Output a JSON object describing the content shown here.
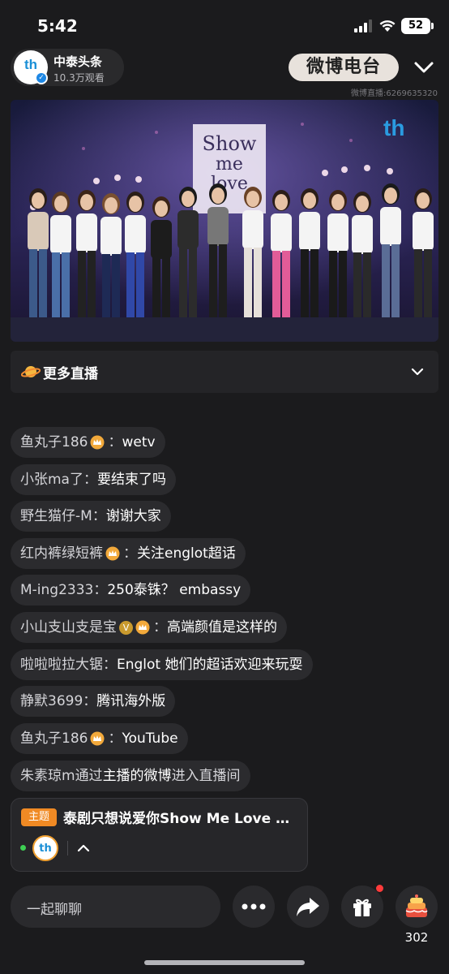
{
  "status_bar": {
    "time": "5:42",
    "battery": "52"
  },
  "header": {
    "host_name": "中泰头条",
    "viewers": "10.3万观看",
    "radio_logo": "微博电台",
    "stream_id": "微博直播:6269635320"
  },
  "video": {
    "overlay_logo": "th",
    "sign_text": [
      "Show",
      "me",
      "love"
    ]
  },
  "more_live": {
    "label": "更多直播"
  },
  "comments": [
    {
      "user": "鱼丸子186",
      "crown": true,
      "verified": false,
      "text": "wetv"
    },
    {
      "user": "小张ma了",
      "crown": false,
      "verified": false,
      "text": "要结束了吗"
    },
    {
      "user": "野生猫仔-M",
      "crown": false,
      "verified": false,
      "text": "谢谢大家"
    },
    {
      "user": "红内裤绿短裤",
      "crown": true,
      "verified": false,
      "text": "关注englot超话"
    },
    {
      "user": "M-ing2333",
      "crown": false,
      "verified": false,
      "text": "250泰铢？ embassy"
    },
    {
      "user": "小山支山支是宝",
      "crown": true,
      "verified": true,
      "text": "高端颜值是这样的"
    },
    {
      "user": "啦啦啦拉大锯",
      "crown": false,
      "verified": false,
      "text": "Englot 她们的超话欢迎来玩耍"
    },
    {
      "user": "静默3699",
      "crown": false,
      "verified": false,
      "text": "腾讯海外版"
    },
    {
      "user": "鱼丸子186",
      "crown": true,
      "verified": false,
      "text": "YouTube"
    }
  ],
  "system_message": {
    "user": "朱素琼m",
    "prefix": "通过",
    "highlight": "主播的微博",
    "suffix": "进入直播间"
  },
  "topic": {
    "tag": "主题",
    "title": "泰剧只想说爱你Show Me Love 新...",
    "avatar_text": "th"
  },
  "bottom_bar": {
    "chat_placeholder": "一起聊聊",
    "gift_count": "302"
  },
  "colors": {
    "background": "#1b1b1d",
    "bubble": "#2b2b2e",
    "topic_tag": "#f08a24",
    "brand_blue": "#1a8fd6",
    "online_green": "#3ecf53",
    "notification_red": "#ff3b3b"
  }
}
